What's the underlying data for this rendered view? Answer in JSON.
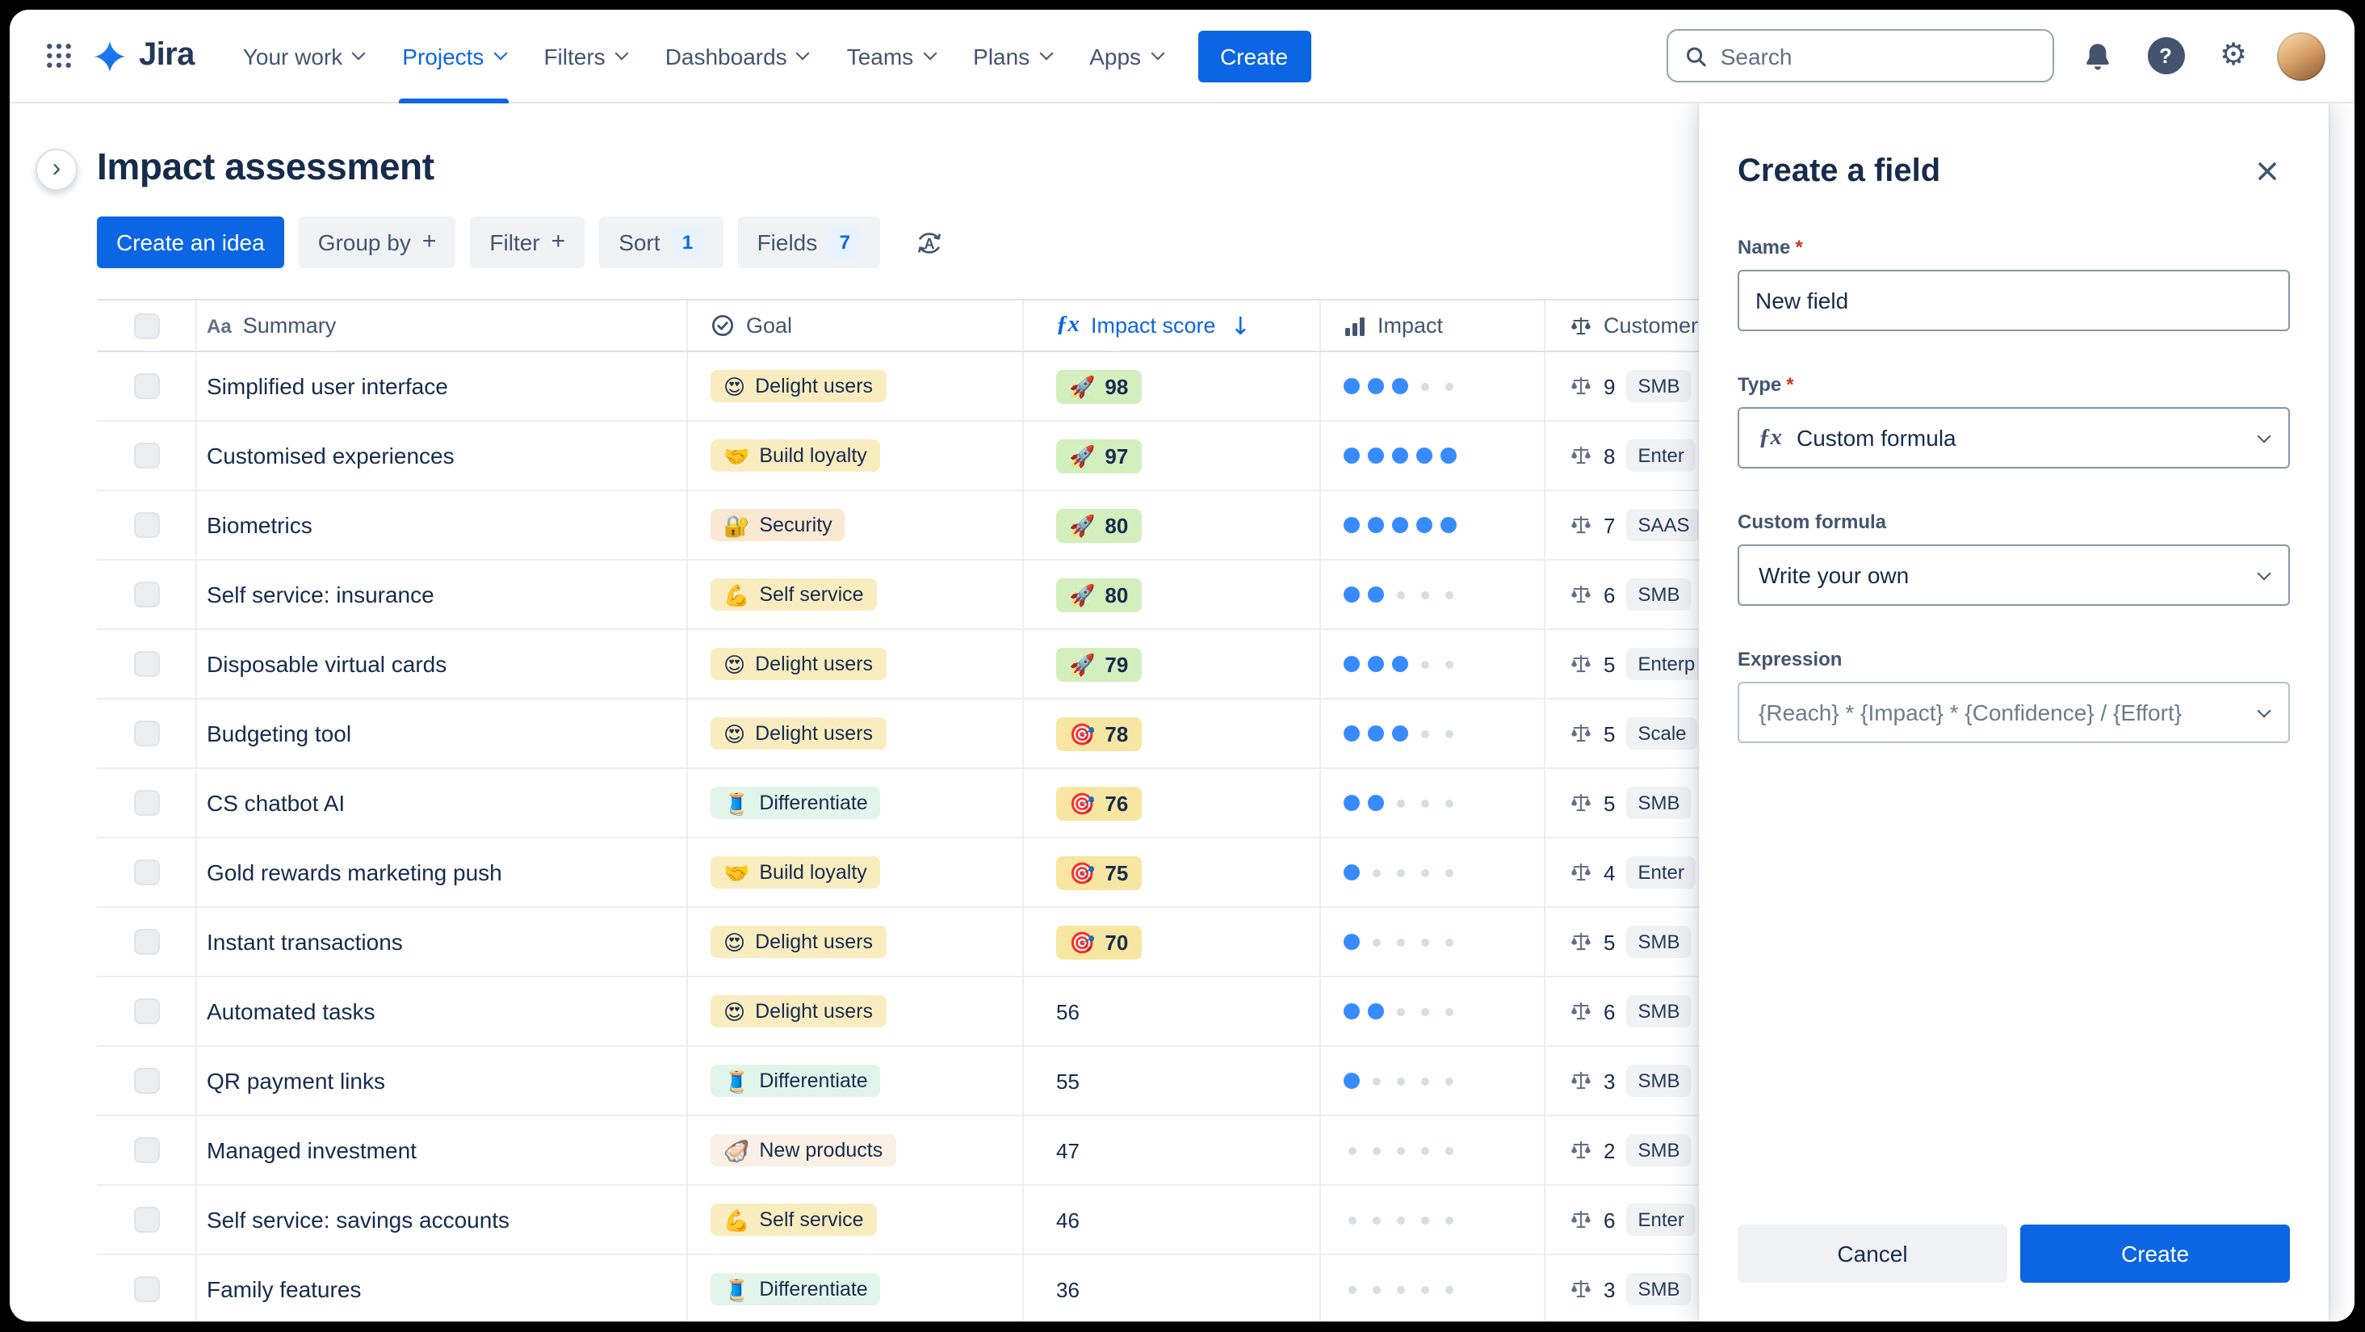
{
  "nav": {
    "brand": "Jira",
    "items": [
      {
        "label": "Your work",
        "active": false
      },
      {
        "label": "Projects",
        "active": true
      },
      {
        "label": "Filters",
        "active": false
      },
      {
        "label": "Dashboards",
        "active": false
      },
      {
        "label": "Teams",
        "active": false
      },
      {
        "label": "Plans",
        "active": false
      },
      {
        "label": "Apps",
        "active": false
      }
    ],
    "create_label": "Create",
    "search_placeholder": "Search"
  },
  "icons": {
    "gear_glyph": "⚙",
    "help_glyph": "?",
    "plus_glyph": "+",
    "sort_arrow_glyph": "↓",
    "fx_glyph": "ƒx",
    "summary_type_glyph": "Aa",
    "collapse_glyph": "›",
    "az_glyph": "A"
  },
  "page": {
    "title": "Impact assessment",
    "toolbar": {
      "create_idea_label": "Create an idea",
      "group_by_label": "Group by",
      "filter_label": "Filter",
      "sort_label": "Sort",
      "sort_count": "1",
      "fields_label": "Fields",
      "fields_count": "7"
    }
  },
  "table": {
    "headers": {
      "summary": "Summary",
      "goal": "Goal",
      "impact_score": "Impact score",
      "impact": "Impact",
      "customer": "Customer"
    },
    "rows": [
      {
        "summary": "Simplified user interface",
        "goal": {
          "emoji": "😍",
          "label": "Delight users",
          "color": "#F9EDC0"
        },
        "score": {
          "emoji": "🚀",
          "value": "98",
          "color": "#D3EFBD"
        },
        "impact": 3,
        "customer": {
          "value": "9",
          "segment": "SMB"
        }
      },
      {
        "summary": "Customised experiences",
        "goal": {
          "emoji": "🤝",
          "label": "Build loyalty",
          "color": "#F9EDC0"
        },
        "score": {
          "emoji": "🚀",
          "value": "97",
          "color": "#D3EFBD"
        },
        "impact": 5,
        "customer": {
          "value": "8",
          "segment": "Enter"
        }
      },
      {
        "summary": "Biometrics",
        "goal": {
          "emoji": "🔐",
          "label": "Security",
          "color": "#FBE8D2"
        },
        "score": {
          "emoji": "🚀",
          "value": "80",
          "color": "#D3EFBD"
        },
        "impact": 5,
        "customer": {
          "value": "7",
          "segment": "SAAS"
        }
      },
      {
        "summary": "Self service: insurance",
        "goal": {
          "emoji": "💪",
          "label": "Self service",
          "color": "#F9EDC0"
        },
        "score": {
          "emoji": "🚀",
          "value": "80",
          "color": "#D3EFBD"
        },
        "impact": 2,
        "customer": {
          "value": "6",
          "segment": "SMB"
        }
      },
      {
        "summary": "Disposable virtual cards",
        "goal": {
          "emoji": "😍",
          "label": "Delight users",
          "color": "#F9EDC0"
        },
        "score": {
          "emoji": "🚀",
          "value": "79",
          "color": "#D3EFBD"
        },
        "impact": 3,
        "customer": {
          "value": "5",
          "segment": "Enterp"
        }
      },
      {
        "summary": "Budgeting tool",
        "goal": {
          "emoji": "😍",
          "label": "Delight users",
          "color": "#F9EDC0"
        },
        "score": {
          "emoji": "🎯",
          "value": "78",
          "color": "#F7E6A1"
        },
        "impact": 3,
        "customer": {
          "value": "5",
          "segment": "Scale"
        }
      },
      {
        "summary": "CS chatbot AI",
        "goal": {
          "emoji": "🧵",
          "label": "Differentiate",
          "color": "#E1F5EA"
        },
        "score": {
          "emoji": "🎯",
          "value": "76",
          "color": "#F7E6A1"
        },
        "impact": 2,
        "customer": {
          "value": "5",
          "segment": "SMB"
        }
      },
      {
        "summary": "Gold rewards marketing push",
        "goal": {
          "emoji": "🤝",
          "label": "Build loyalty",
          "color": "#F9EDC0"
        },
        "score": {
          "emoji": "🎯",
          "value": "75",
          "color": "#F7E6A1"
        },
        "impact": 1,
        "customer": {
          "value": "4",
          "segment": "Enter"
        }
      },
      {
        "summary": "Instant transactions",
        "goal": {
          "emoji": "😍",
          "label": "Delight users",
          "color": "#F9EDC0"
        },
        "score": {
          "emoji": "🎯",
          "value": "70",
          "color": "#F7E6A1"
        },
        "impact": 1,
        "customer": {
          "value": "5",
          "segment": "SMB"
        }
      },
      {
        "summary": "Automated tasks",
        "goal": {
          "emoji": "😍",
          "label": "Delight users",
          "color": "#F9EDC0"
        },
        "score": {
          "value": "56"
        },
        "impact": 2,
        "customer": {
          "value": "6",
          "segment": "SMB"
        }
      },
      {
        "summary": "QR payment links",
        "goal": {
          "emoji": "🧵",
          "label": "Differentiate",
          "color": "#E1F5EA"
        },
        "score": {
          "value": "55"
        },
        "impact": 1,
        "customer": {
          "value": "3",
          "segment": "SMB"
        }
      },
      {
        "summary": "Managed investment",
        "goal": {
          "emoji": "🦪",
          "label": "New products",
          "color": "#FAF0E5"
        },
        "score": {
          "value": "47"
        },
        "impact": 0,
        "customer": {
          "value": "2",
          "segment": "SMB"
        }
      },
      {
        "summary": "Self service: savings accounts",
        "goal": {
          "emoji": "💪",
          "label": "Self service",
          "color": "#F9EDC0"
        },
        "score": {
          "value": "46"
        },
        "impact": 0,
        "customer": {
          "value": "6",
          "segment": "Enter"
        }
      },
      {
        "summary": "Family features",
        "goal": {
          "emoji": "🧵",
          "label": "Differentiate",
          "color": "#E1F5EA"
        },
        "score": {
          "value": "36"
        },
        "impact": 0,
        "customer": {
          "value": "3",
          "segment": "SMB"
        }
      }
    ]
  },
  "panel": {
    "title": "Create a field",
    "required_mark": "*",
    "name_label": "Name",
    "name_value": "New field",
    "type_label": "Type",
    "type_value": "Custom formula",
    "custom_formula_label": "Custom formula",
    "custom_formula_value": "Write your own",
    "expression_label": "Expression",
    "expression_value": "{Reach} * {Impact} * {Confidence} / {Effort}",
    "cancel_label": "Cancel",
    "create_label": "Create"
  },
  "colors": {
    "accent_blue": "#0C66E4",
    "score_green": "#D3EFBD",
    "score_yellow": "#F7E6A1",
    "impact_dot_blue": "#388BFF",
    "required_red": "#CA3521"
  }
}
